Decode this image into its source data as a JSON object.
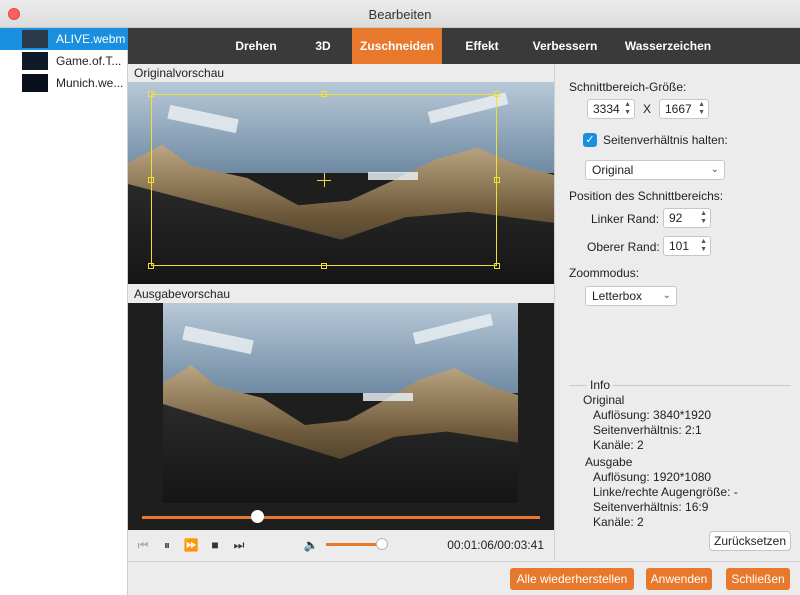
{
  "window": {
    "title": "Bearbeiten"
  },
  "files": [
    {
      "name": "ALIVE.webm",
      "selected": true
    },
    {
      "name": "Game.of.T...",
      "selected": false
    },
    {
      "name": "Munich.we...",
      "selected": false
    }
  ],
  "tabs": [
    {
      "label": "Drehen",
      "active": false
    },
    {
      "label": "3D",
      "active": false
    },
    {
      "label": "Zuschneiden",
      "active": true
    },
    {
      "label": "Effekt",
      "active": false
    },
    {
      "label": "Verbessern",
      "active": false
    },
    {
      "label": "Wasserzeichen",
      "active": false
    }
  ],
  "preview": {
    "original_label": "Originalvorschau",
    "output_label": "Ausgabevorschau",
    "playback_progress": 0.29,
    "volume_level": 0.9,
    "timecode": "00:01:06/00:03:41"
  },
  "crop": {
    "size_label": "Schnittbereich-Größe:",
    "width": "3334",
    "separator": "X",
    "height": "1667",
    "keep_ratio_label": "Seitenverhältnis halten:",
    "keep_ratio_checked": true,
    "ratio_value": "Original",
    "position_label": "Position des Schnittbereichs:",
    "left_label": "Linker Rand:",
    "left_value": "92",
    "top_label": "Oberer Rand:",
    "top_value": "101",
    "zoom_label": "Zoommodus:",
    "zoom_value": "Letterbox"
  },
  "info": {
    "title": "Info",
    "original_heading": "Original",
    "original_resolution": "Auflösung: 3840*1920",
    "original_ratio": "Seitenverhältnis: 2:1",
    "original_channels": "Kanäle: 2",
    "output_heading": "Ausgabe",
    "output_resolution": "Auflösung: 1920*1080",
    "output_eye": "Linke/rechte Augengröße: -",
    "output_ratio": "Seitenverhältnis: 16:9",
    "output_channels": "Kanäle: 2"
  },
  "buttons": {
    "reset": "Zurücksetzen",
    "restore_all": "Alle wiederherstellen",
    "apply": "Anwenden",
    "close": "Schließen"
  },
  "colors": {
    "accent": "#e8782b",
    "selection": "#1a8fe0",
    "crop_frame": "#f0e030"
  }
}
